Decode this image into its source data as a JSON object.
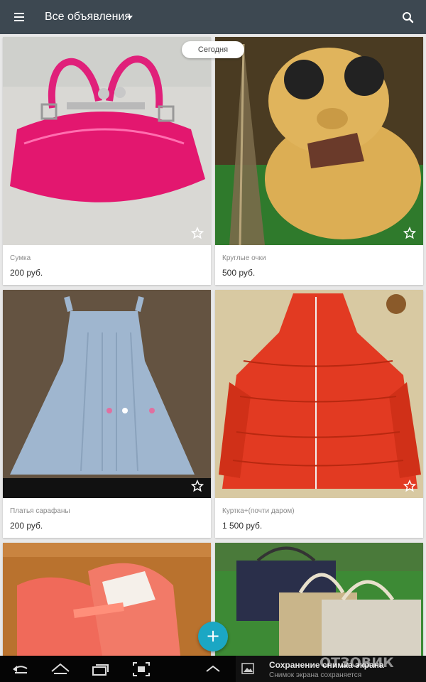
{
  "app_bar": {
    "title": "Все объявления",
    "icons": [
      "menu-icon",
      "dropdown-caret-icon",
      "search-icon"
    ],
    "background": "#3d4851"
  },
  "date_chip": "Сегодня",
  "listings": [
    {
      "name": "Сумка",
      "price": "200 руб.",
      "photo": "pink handbag"
    },
    {
      "name": "Круглые очки",
      "price": "500 руб.",
      "photo": "teddy bear with sunglasses"
    },
    {
      "name": "Платья сарафаны",
      "price": "200 руб.",
      "photo": "denim sundress"
    },
    {
      "name": "Куртка+(почти даром)",
      "price": "1 500 руб.",
      "photo": "red quilted jacket"
    },
    {
      "name": "",
      "price": "",
      "photo": "pink shoes"
    },
    {
      "name": "",
      "price": "",
      "photo": "handbags on grass"
    }
  ],
  "fab": {
    "label": "+",
    "color": "#1ba7c4"
  },
  "system_bar": {
    "notification_title": "Сохранение снимка экрана",
    "notification_subtitle": "Снимок экрана сохраняется",
    "watermark": "ОТЗОВИК"
  }
}
